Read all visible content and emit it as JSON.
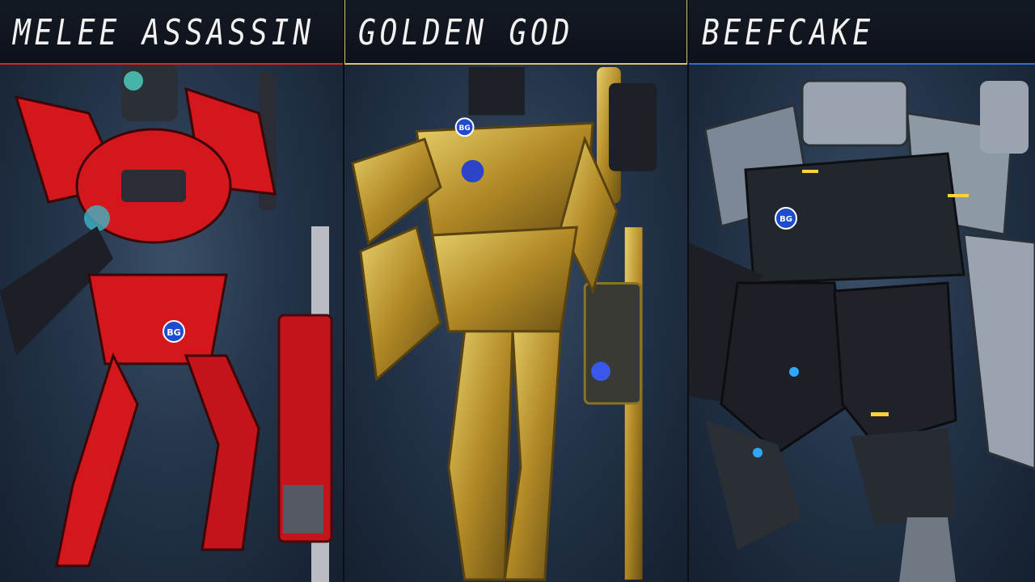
{
  "panels": [
    {
      "title": "MELEE ASSASSIN",
      "accent": "#d8242b",
      "mech_color": "#d4161d",
      "emblem": "BG"
    },
    {
      "title": "GOLDEN GOD",
      "accent": "#d7c27a",
      "mech_color": "#b8952e",
      "emblem": "BG"
    },
    {
      "title": "BEEFCAKE",
      "accent": "#3b6ad6",
      "mech_color": "#2a2f38",
      "emblem": "BG"
    }
  ]
}
